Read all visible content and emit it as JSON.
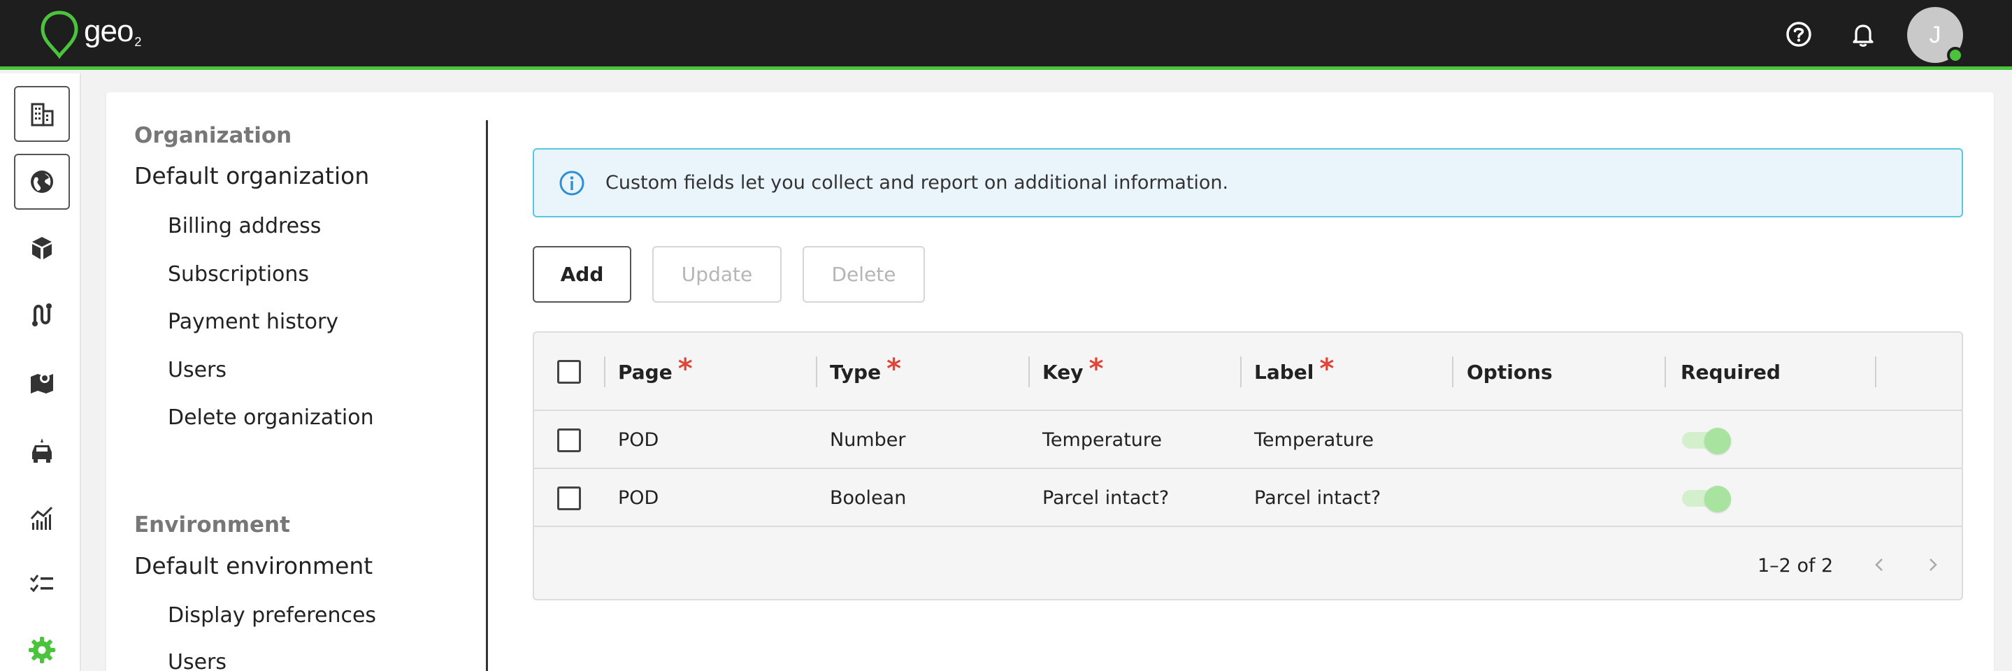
{
  "app": {
    "brand": "geo",
    "brand_sub": "2",
    "user_initial": "J",
    "accent_color": "#4cc33c"
  },
  "topbar_icons": [
    "help-circle-icon",
    "bell-icon"
  ],
  "rail_items": [
    {
      "icon": "building-icon",
      "selected": true
    },
    {
      "icon": "globe-icon",
      "selected": true
    },
    {
      "icon": "package-icon"
    },
    {
      "icon": "route-icon"
    },
    {
      "icon": "map-icon"
    },
    {
      "icon": "vehicle-icon"
    },
    {
      "icon": "analytics-icon"
    },
    {
      "icon": "checklist-icon"
    },
    {
      "icon": "gear-icon",
      "active": true
    }
  ],
  "settings_nav": {
    "organization": {
      "heading": "Organization",
      "name": "Default organization",
      "items": [
        "Billing address",
        "Subscriptions",
        "Payment history",
        "Users",
        "Delete organization"
      ]
    },
    "environment": {
      "heading": "Environment",
      "name": "Default environment",
      "items": [
        "Display preferences",
        "Users"
      ]
    }
  },
  "banner": {
    "icon": "info-icon",
    "text": "Custom fields let you collect and report on additional information."
  },
  "actions": {
    "add": "Add",
    "update": "Update",
    "delete": "Delete"
  },
  "table": {
    "columns": [
      {
        "label": "Page",
        "required": true
      },
      {
        "label": "Type",
        "required": true
      },
      {
        "label": "Key",
        "required": true
      },
      {
        "label": "Label",
        "required": true
      },
      {
        "label": "Options",
        "required": false
      },
      {
        "label": "Required",
        "required": false
      }
    ],
    "required_mark": "*",
    "rows": [
      {
        "page": "POD",
        "type": "Number",
        "key": "Temperature",
        "label": "Temperature",
        "options": "",
        "required": true
      },
      {
        "page": "POD",
        "type": "Boolean",
        "key": "Parcel intact?",
        "label": "Parcel intact?",
        "options": "",
        "required": true
      }
    ],
    "pagination": "1–2 of 2"
  }
}
